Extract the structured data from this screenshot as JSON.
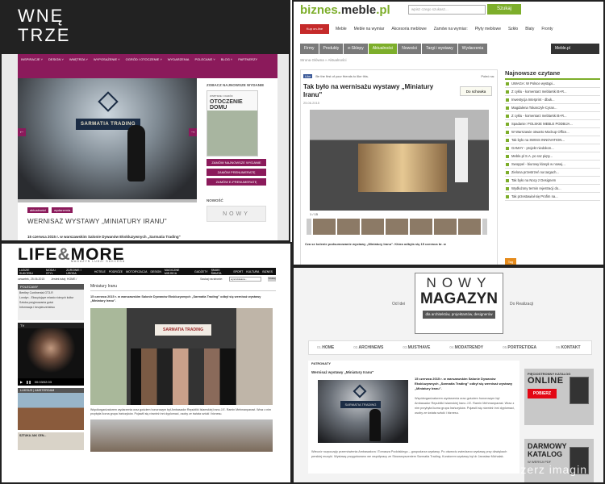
{
  "p1": {
    "logo": "WNĘ\nTRZE",
    "nav": [
      "INSPIRACJE ˅",
      "DESIGN ˅",
      "WNĘTRZA ˅",
      "WYPOSAŻENIE ˅",
      "OGRÓD I OTOCZENIE ˅",
      "WYDARZENIA",
      "POLECANE ˅",
      "BLOG ˅",
      "PARTNERZY"
    ],
    "slide_banner": "SARMATIA TRADING",
    "arrow_left": "←",
    "arrow_right": "→",
    "tags": [
      "aktualności",
      "wydarzenia"
    ],
    "title": "WERNISAŻ WYSTAWY „MINIATURY IRANU\"",
    "lead": "15 czerwca 2015 r. w warszawskim Salonie Dywanów Ekskluzywnych „Sarmatia Trading\"",
    "side_heading": "ZOBACZ NAJNOWSZE WYDANIE",
    "mag_small": "WNĘTRZE I OGRÓD",
    "mag_title": "OTOCZENIE DOMU",
    "buttons": [
      "ZAMÓW NAJNOWSZE WYDANIE",
      "ZAMÓW PRENUMERATĘ",
      "ZAMÓW E-PRENUMERATĘ"
    ],
    "side_heading2": "NOWOŚĆ",
    "box_text": "NOWY",
    "accent": "#8b1a5b"
  },
  "p2": {
    "brand_a": "biznes.",
    "brand_b": "meble",
    "brand_c": ".pl",
    "search_placeholder": "wpisz czego szukasz...",
    "search_button": "Szukaj",
    "icon_label": "Kup on-line",
    "nav": [
      "Meble",
      "Meble na wymiar",
      "Akcesoria meblowe",
      "Zamów na wymiar:",
      "Płyty meblowe",
      "Szkło",
      "Blaty",
      "Fronty"
    ],
    "tabs": [
      "Firmy",
      "Produkty",
      "e-Sklepy",
      "Aktualności",
      "Nowości",
      "Targi i wystawy",
      "Wydarzenia"
    ],
    "tab_right": "Meble.pl",
    "crumb": "Strona Główna » Aktualności",
    "fb_like": "Like",
    "fb_text": "Be the first of your friends to like this.",
    "share": "Poleć na: ",
    "title": "Tak było na wernisażu wystawy „Miniatury Iranu\"",
    "date": "25.06.2015",
    "dosch": "Do schowka",
    "counter": "1 / 15",
    "caption": "Cza se kolenie podsumowanie wystawy „Miniatury Iranu\". Która odbyła się 15 czerwca br. w",
    "side_heading": "Najnowsze czytane",
    "side_items": [
      "UWAGA: W Polsce wystąpi...",
      "Z cyklu - komentarz meblarski B+R...",
      "Inwestycja Interprint - dbuk...",
      "Magdalena Tokarczyk-Cyran...",
      "Z cyklu - komentarz meblarski B+R...",
      "Spadanie: POLSKIE MEBLE PODBIJA...",
      "W Warszawie otwarto Mockup Office...",
      "Tak było na SWISS INNOVATION...",
      "GAMAY - projekt niedokon...",
      "Meble.pl S.A. po raz pięty...",
      "Swoppel - biurowy klasyk w nowej...",
      "Zielona przestrzeń na targach...",
      "Tak było na Nocy z Designem",
      "Wydłużony termin rejestracji do...",
      "Tak przestawiał się Profim na..."
    ],
    "tag": "Tag",
    "accent": "#7dae2b"
  },
  "p3": {
    "logo_a": "LIFE",
    "logo_b": "&",
    "logo_c": "MORE",
    "sub": "MAGAZYN LUDZI SUKCESU",
    "nav": [
      "LUDZIE SUKCESU",
      "MODA I STYL",
      "ZDROWIE I URODA",
      "HOTELE",
      "PODRÓŻE",
      "MOTORYZACJA",
      "DESIGN",
      "MAGICZNE MIEJSCA",
      "GADŻETY",
      "SMAKI ŚWIATA",
      "SPORT",
      "KULTURA",
      "BIZNES"
    ],
    "date": "czwartek, 25.06.2015",
    "crumb": "Jesteś tutaj: HOME /",
    "search_label": "Szukaj na stronie:",
    "search_placeholder": "wyszukiwana...",
    "search_button": "Szukaj",
    "left_heading": "POLECAMY",
    "left_items": [
      "Bentley Continental GT3-R",
      "Londyn - Ekscytujące miasto różnych kultur",
      "Sztuka przyjmowania gości",
      "Informacja i bezpieczeństwo"
    ],
    "tv": "TV",
    "video_time": "00:03/02:03",
    "lux": "LUKSUS | AMSTERDAM",
    "gift": "SZTUKA JAK CEN... ",
    "main_title": "Miniatury Iranu",
    "lead": "15 czerwca 2015 r. w warszawskim Salonie Dywanów Ekskluzywnych „Sarmatia Trading\" odbył się wernisaż wystawy „Miniatury Iranu\".",
    "store": "SARMATIA TRADING",
    "text": "Współorganizatorem wydarzenia oraz gościem honorowym był Ambasador Republiki Islamskiej Iranu J.E. Ramin Mehmanparast. Wraz z nim przybyła liczna grupa Irańczyków. Pojawili się również inni dyplomaci, osoby ze świata sztuki i biznesu."
  },
  "p4": {
    "nowy": "NOWY",
    "magazyn": "MAGAZYN",
    "dla": "dla architektów, projektantów, designerów",
    "od_idei": "Od Idei",
    "do_realizacji": "Do Realizacji",
    "menu": [
      {
        "n": "01.",
        "t": "HOME"
      },
      {
        "n": "02.",
        "t": "ARCHINEWS"
      },
      {
        "n": "03.",
        "t": "MUSTHAVE"
      },
      {
        "n": "04.",
        "t": "MODATRENDY"
      },
      {
        "n": "05.",
        "t": "PORTRETIDEA"
      },
      {
        "n": "06.",
        "t": "KONTAKT"
      }
    ],
    "patronaty": "PATRONATY",
    "title": "Wernisaż wystawy „Miniatury Iranu\"",
    "banner": "SARMATIA TRADING",
    "lead": "15 czerwca 2015 r. w warszawskim Salonie Dywanów Ekskluzywnych „Sarmatia Trading\" odbył się wernisaż wystawy „Miniatury Iranu\".",
    "para1": "Współorganizatorem wydarzenia oraz gościem honorowym był Ambasador Republiki Islamskiej Iranu J.E. Ramin Mehmanparast. Wraz z nim przybyła liczna grupa Irańczyków. Pojawili się również inni dyplomaci, osoby ze świata sztuki i biznesu.",
    "para2": "Wieczór rozpoczęły przemówienia Ambasadora i Tomasza Podolskiego – gospodarza wystawy. Po otwarciu zwiedzano wystawę przy dźwiękach perskiej muzyki. Wystawę przygotowano we współpracy ze Stowarzyszeniem Sarmatia Trading. Kuratorem wystawy był dr Jarosław Michalak.",
    "ad1_small": "PIĘCIOSTRONNY KATALOG",
    "ad1_big": "ONLINE",
    "ad1_btn": "POBIERZ",
    "ad2_big": "DARMOWY KATALOG",
    "ad2_small": "W WERSJI PDF",
    "watermark": "Rozszerz imagin"
  }
}
